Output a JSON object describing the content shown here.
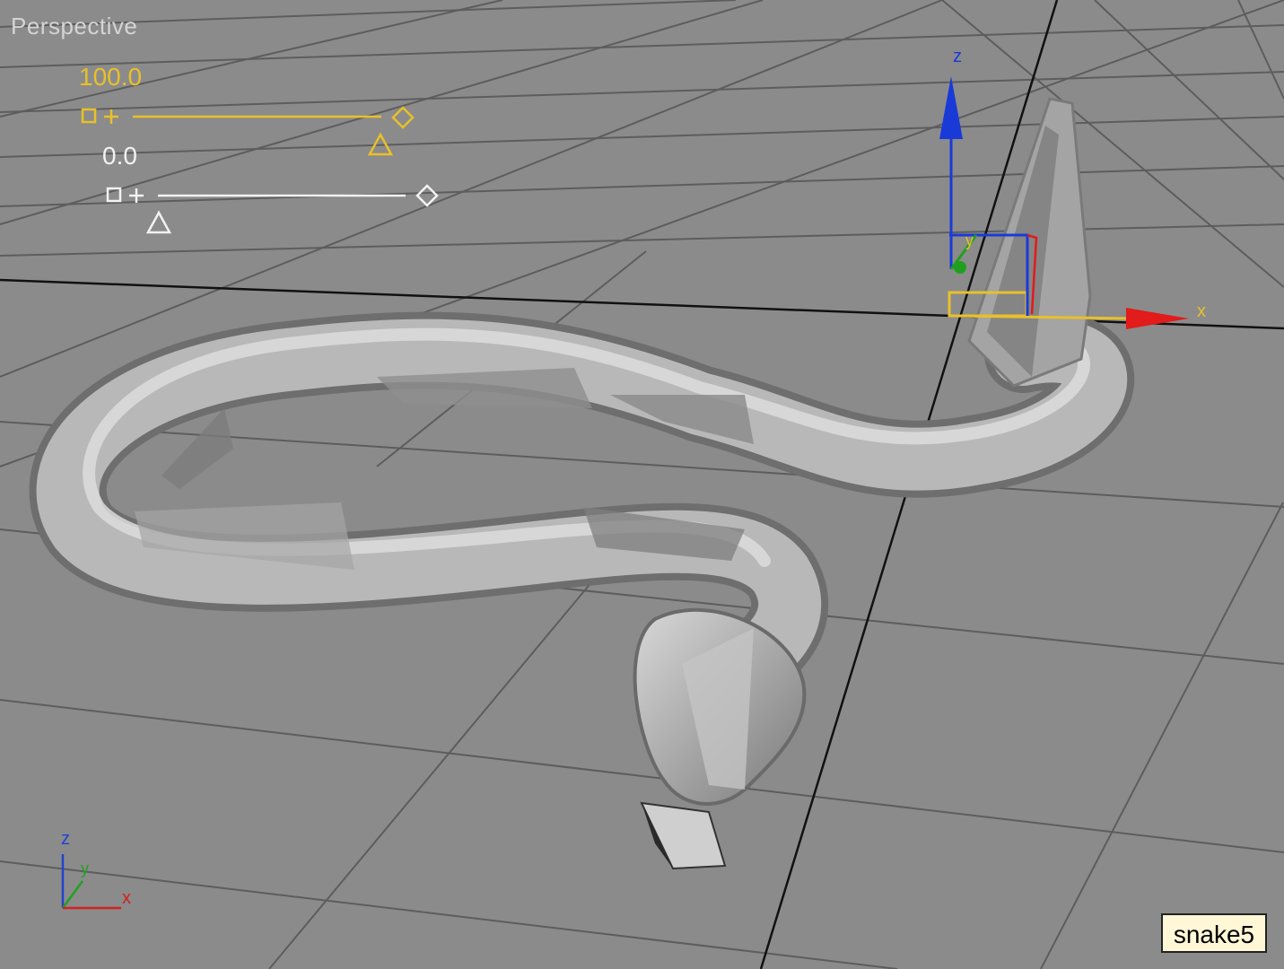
{
  "viewport": {
    "label": "Perspective",
    "selected_object": "snake5"
  },
  "morph_sliders": [
    {
      "value": "100.0",
      "state": "active",
      "color": "#e8c02a"
    },
    {
      "value": "0.0",
      "state": "inactive",
      "color": "#f2f2f2"
    }
  ],
  "gizmo": {
    "axes": {
      "x": "x",
      "y": "y",
      "z": "z"
    },
    "colors": {
      "x": "#e21b1b",
      "y": "#1ea01e",
      "z": "#1a3ad8",
      "plane": "#e8c02a"
    }
  },
  "mini_axis": {
    "labels": {
      "x": "x",
      "y": "y",
      "z": "z"
    },
    "colors": {
      "x": "#d42020",
      "y": "#22a022",
      "z": "#2244cc"
    }
  },
  "colors": {
    "background": "#8b8b8b",
    "grid": "#5d5d5d",
    "world_axis": "#111111",
    "snake": "#b9b9b9"
  }
}
